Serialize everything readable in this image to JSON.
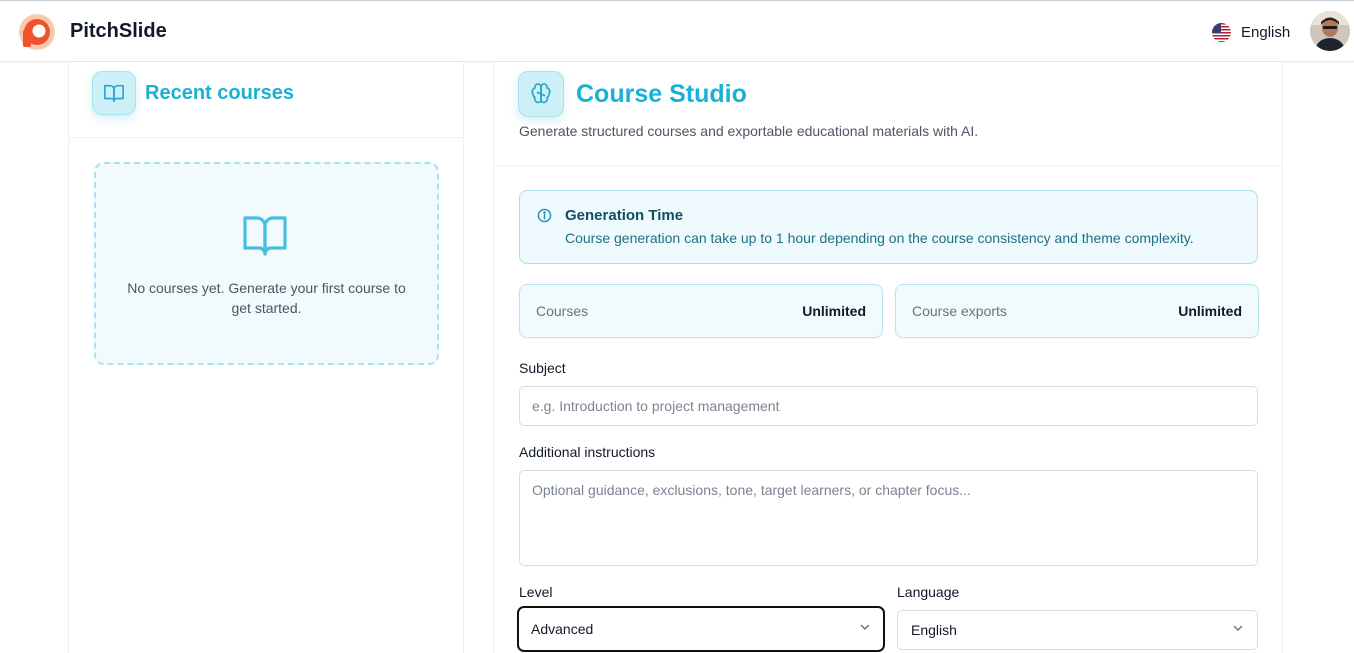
{
  "app": {
    "brand": "PitchSlide",
    "language": "English"
  },
  "sidebar": {
    "title": "Recent courses",
    "empty_message": "No courses yet. Generate your first course to get started."
  },
  "studio": {
    "title": "Course Studio",
    "subtitle": "Generate structured courses and exportable educational materials with AI.",
    "notice": {
      "title": "Generation Time",
      "text": "Course generation can take up to 1 hour depending on the course consistency and theme complexity."
    },
    "stats": [
      {
        "label": "Courses",
        "value": "Unlimited"
      },
      {
        "label": "Course exports",
        "value": "Unlimited"
      }
    ],
    "form": {
      "subject": {
        "label": "Subject",
        "value": "",
        "placeholder": "e.g. Introduction to project management"
      },
      "instructions": {
        "label": "Additional instructions",
        "value": "",
        "placeholder": "Optional guidance, exclusions, tone, target learners, or chapter focus..."
      },
      "level": {
        "label": "Level",
        "selected": "Advanced"
      },
      "language": {
        "label": "Language",
        "selected": "English"
      }
    }
  },
  "colors": {
    "accent": "#1bb1d6",
    "accent_light": "#cdeff7",
    "brand_orange": "#f0532b"
  },
  "icons": {
    "logo": "pitchslide-logo-icon",
    "flag": "us-flag-icon",
    "book": "book-open-icon",
    "brain": "brain-icon",
    "info": "info-circle-icon",
    "chevron": "chevron-down-icon"
  }
}
